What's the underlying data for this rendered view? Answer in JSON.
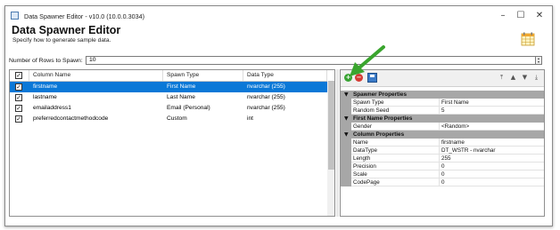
{
  "window": {
    "title": "Data Spawner Editor - v10.0 (10.0.0.3034)",
    "controls": {
      "minimize": "–",
      "maximize": "☐",
      "close": "✕"
    }
  },
  "header": {
    "title": "Data Spawner Editor",
    "subtitle": "Specify how to generate sample data.",
    "icon": "table-grid-icon"
  },
  "rows_to_spawn": {
    "label": "Number of Rows to Spawn:",
    "value": "10"
  },
  "grid": {
    "columns": [
      "Column Name",
      "Spawn Type",
      "Data Type"
    ],
    "rows": [
      {
        "checked": true,
        "column_name": "firstname",
        "spawn_type": "First Name",
        "data_type": "nvarchar (255)",
        "selected": true
      },
      {
        "checked": true,
        "column_name": "lastname",
        "spawn_type": "Last Name",
        "data_type": "nvarchar (255)",
        "selected": false
      },
      {
        "checked": true,
        "column_name": "emailaddress1",
        "spawn_type": "Email (Personal)",
        "data_type": "nvarchar (255)",
        "selected": false
      },
      {
        "checked": true,
        "column_name": "preferredcontactmethodcode",
        "spawn_type": "Custom",
        "data_type": "int",
        "selected": false
      }
    ]
  },
  "properties": {
    "toolbar": {
      "add": "+",
      "remove": "−",
      "add_icon": "green-add-icon",
      "remove_icon": "red-remove-icon",
      "save_icon": "save-icon",
      "move_top": "⤒",
      "move_up": "▲",
      "move_down": "▼",
      "move_bottom": "⤓"
    },
    "sections": [
      {
        "title": "Spawner Properties",
        "items": [
          {
            "name": "Spawn Type",
            "value": "First Name"
          },
          {
            "name": "Random Seed",
            "value": "5"
          }
        ]
      },
      {
        "title": "First Name Properties",
        "items": [
          {
            "name": "Gender",
            "value": "<Random>"
          }
        ]
      },
      {
        "title": "Column Properties",
        "items": [
          {
            "name": "Name",
            "value": "firstname"
          },
          {
            "name": "DataType",
            "value": "DT_WSTR - nvarchar"
          },
          {
            "name": "Length",
            "value": "255"
          },
          {
            "name": "Precision",
            "value": "0"
          },
          {
            "name": "Scale",
            "value": "0"
          },
          {
            "name": "CodePage",
            "value": "0"
          }
        ]
      }
    ]
  },
  "colors": {
    "selection": "#0a78d7",
    "section_band": "#a7a7a7",
    "annotation_arrow": "#3aa52e"
  }
}
